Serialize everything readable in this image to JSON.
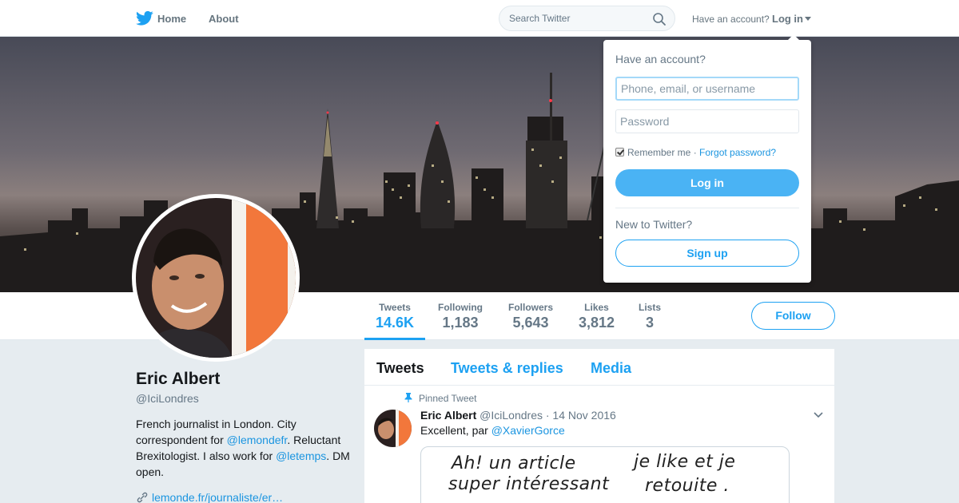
{
  "nav": {
    "home_label": "Home",
    "about_label": "About",
    "search_placeholder": "Search Twitter",
    "have_account": "Have an account?",
    "login_label": "Log in"
  },
  "stats": [
    {
      "label": "Tweets",
      "value": "14.6K"
    },
    {
      "label": "Following",
      "value": "1,183"
    },
    {
      "label": "Followers",
      "value": "5,643"
    },
    {
      "label": "Likes",
      "value": "3,812"
    },
    {
      "label": "Lists",
      "value": "3"
    }
  ],
  "follow_label": "Follow",
  "profile": {
    "name": "Eric Albert",
    "handle": "@IciLondres",
    "bio_1": "French journalist in London. City correspondent for ",
    "bio_mention_1": "@lemondefr",
    "bio_2": ". Reluctant Brexitologist. I also work for ",
    "bio_mention_2": "@letemps",
    "bio_3": ". DM open.",
    "link": "lemonde.fr/journaliste/er…"
  },
  "timeline": {
    "tabs": [
      "Tweets",
      "Tweets & replies",
      "Media"
    ],
    "pinned_label": "Pinned Tweet",
    "tweet": {
      "name": "Eric Albert",
      "meta": "@IciLondres · 14 Nov 2016",
      "text": "Excellent, par ",
      "mention": "@XavierGorce",
      "media_text": [
        "Ah! un article",
        "super intéressant",
        "je like et je",
        "retouite ."
      ]
    }
  },
  "login_dropdown": {
    "title": "Have an account?",
    "username_placeholder": "Phone, email, or username",
    "password_placeholder": "Password",
    "remember_label": "Remember me · ",
    "forgot_label": "Forgot password?",
    "login_button": "Log in",
    "new_label": "New to Twitter?",
    "signup_button": "Sign up"
  },
  "colors": {
    "brand": "#1da1f2",
    "link": "#1b95e0",
    "login_button": "#4ab3f4"
  }
}
